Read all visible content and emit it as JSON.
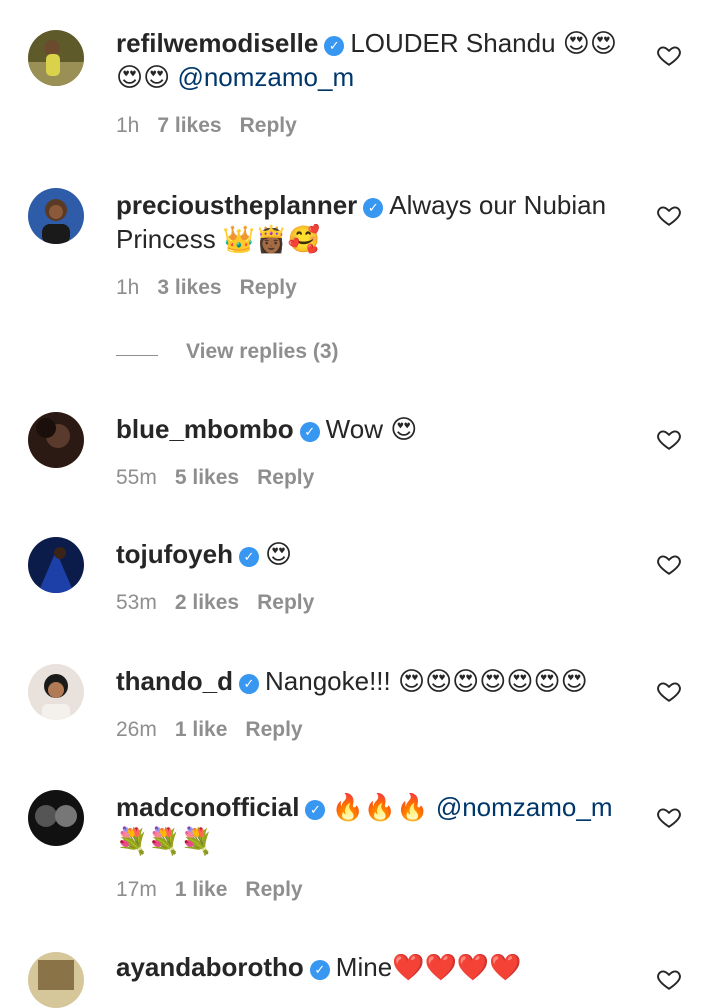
{
  "comments": [
    {
      "username": "refilwemodiselle",
      "verified": true,
      "text_before": "LOUDER Shandu 😍😍 😍😍 ",
      "mention": "@nomzamo_m",
      "text_after": "",
      "time": "1h",
      "likes": "7 likes",
      "reply": "Reply",
      "avatar_color": "#7f7a3a"
    },
    {
      "username": "precioustheplanner",
      "verified": true,
      "text_before": "Always our Nubian Princess 👑👸🏾🥰",
      "mention": "",
      "text_after": "",
      "time": "1h",
      "likes": "3 likes",
      "reply": "Reply",
      "avatar_color": "#2f5ca8"
    },
    {
      "username": "blue_mbombo",
      "verified": true,
      "text_before": "Wow 😍",
      "mention": "",
      "text_after": "",
      "time": "55m",
      "likes": "5 likes",
      "reply": "Reply",
      "avatar_color": "#4a3227"
    },
    {
      "username": "tojufoyeh",
      "verified": true,
      "text_before": "😍",
      "mention": "",
      "text_after": "",
      "time": "53m",
      "likes": "2 likes",
      "reply": "Reply",
      "avatar_color": "#1d3fa8"
    },
    {
      "username": "thando_d",
      "verified": true,
      "text_before": "Nangoke!!! 😍😍😍😍😍😍😍",
      "mention": "",
      "text_after": "",
      "time": "26m",
      "likes": "1 like",
      "reply": "Reply",
      "avatar_color": "#d8c3b0"
    },
    {
      "username": "madconofficial",
      "verified": true,
      "text_before": "🔥🔥🔥 ",
      "mention": "@nomzamo_m",
      "text_after": " 💐💐💐",
      "time": "17m",
      "likes": "1 like",
      "reply": "Reply",
      "avatar_color": "#333333"
    },
    {
      "username": "ayandaborotho",
      "verified": true,
      "text_before": "Mine❤️❤️❤️❤️",
      "mention": "",
      "text_after": "",
      "time": "",
      "likes": "",
      "reply": "",
      "avatar_color": "#bca77a"
    }
  ],
  "view_replies": "View replies (3)",
  "colors": {
    "text": "#262626",
    "meta": "#8e8e8e",
    "mention": "#00376b",
    "verified_badge": "#3897f0"
  },
  "icons": {
    "like": "heart-outline-icon",
    "verified": "verified-badge-icon"
  }
}
